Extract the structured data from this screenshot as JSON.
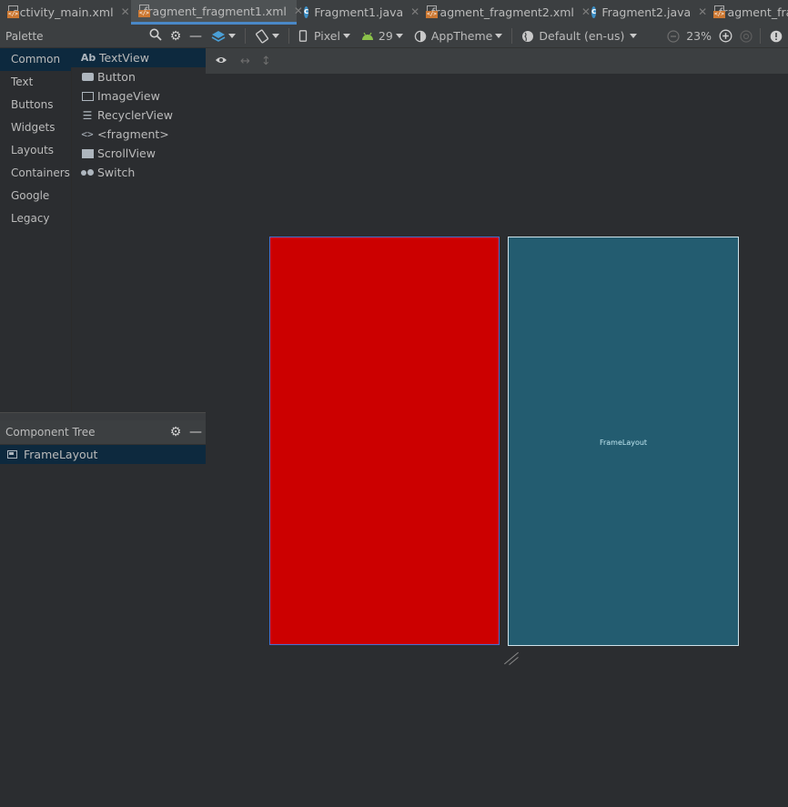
{
  "tabs": [
    {
      "label": "activity_main.xml",
      "type": "xml",
      "active": false
    },
    {
      "label": "fragment_fragment1.xml",
      "type": "xml",
      "active": true
    },
    {
      "label": "Fragment1.java",
      "type": "java",
      "active": false
    },
    {
      "label": "fragment_fragment2.xml",
      "type": "xml",
      "active": false
    },
    {
      "label": "Fragment2.java",
      "type": "java",
      "active": false
    },
    {
      "label": "fragment_fra",
      "type": "xml",
      "active": false
    }
  ],
  "palette": {
    "title": "Palette",
    "categories": [
      "Common",
      "Text",
      "Buttons",
      "Widgets",
      "Layouts",
      "Containers",
      "Google",
      "Legacy"
    ],
    "selected_category": "Common",
    "widgets": [
      {
        "label": "TextView",
        "icon": "textview-icon",
        "glyph": "Ab"
      },
      {
        "label": "Button",
        "icon": "button-icon"
      },
      {
        "label": "ImageView",
        "icon": "imageview-icon"
      },
      {
        "label": "RecyclerView",
        "icon": "recyclerview-icon"
      },
      {
        "label": "<fragment>",
        "icon": "fragment-icon"
      },
      {
        "label": "ScrollView",
        "icon": "scrollview-icon"
      },
      {
        "label": "Switch",
        "icon": "switch-icon"
      }
    ]
  },
  "toolbar": {
    "device": "Pixel",
    "api_level": "29",
    "theme": "AppTheme",
    "locale": "Default (en-us)",
    "zoom": "23%"
  },
  "component_tree": {
    "title": "Component Tree",
    "root": "FrameLayout"
  },
  "canvas": {
    "blueprint_label": "FrameLayout",
    "design_background": "#cc0000",
    "blueprint_background": "#235c70"
  }
}
